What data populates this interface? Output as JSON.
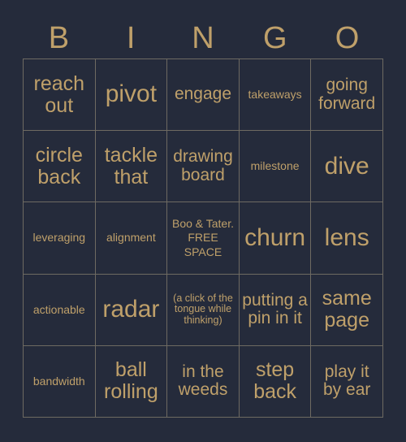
{
  "card": {
    "background_color": "#252b3b",
    "text_color": "#bfa06a",
    "border_color": "#6e6a62"
  },
  "header": {
    "letters": [
      {
        "label": "B"
      },
      {
        "label": "I"
      },
      {
        "label": "N"
      },
      {
        "label": "G"
      },
      {
        "label": "O"
      }
    ]
  },
  "grid": {
    "columns": 5,
    "rows": 5,
    "cells": [
      {
        "text": "reach out",
        "size": "size-lg",
        "row": 1,
        "column": 1,
        "free_space": false
      },
      {
        "text": "pivot",
        "size": "size-xl",
        "row": 1,
        "column": 2,
        "free_space": false
      },
      {
        "text": "engage",
        "size": "size-md",
        "row": 1,
        "column": 3,
        "free_space": false
      },
      {
        "text": "takeaways",
        "size": "size-sm",
        "row": 1,
        "column": 4,
        "free_space": false
      },
      {
        "text": "going forward",
        "size": "size-md",
        "row": 1,
        "column": 5,
        "free_space": false
      },
      {
        "text": "circle back",
        "size": "size-lg",
        "row": 2,
        "column": 1,
        "free_space": false
      },
      {
        "text": "tackle that",
        "size": "size-lg",
        "row": 2,
        "column": 2,
        "free_space": false
      },
      {
        "text": "drawing board",
        "size": "size-md",
        "row": 2,
        "column": 3,
        "free_space": false
      },
      {
        "text": "milestone",
        "size": "size-sm",
        "row": 2,
        "column": 4,
        "free_space": false
      },
      {
        "text": "dive",
        "size": "size-xl",
        "row": 2,
        "column": 5,
        "free_space": false
      },
      {
        "text": "leveraging",
        "size": "size-sm",
        "row": 3,
        "column": 1,
        "free_space": false
      },
      {
        "text": "alignment",
        "size": "size-sm",
        "row": 3,
        "column": 2,
        "free_space": false
      },
      {
        "text": "Boo & Tater. FREE SPACE",
        "size": "size-free",
        "row": 3,
        "column": 3,
        "free_space": true
      },
      {
        "text": "churn",
        "size": "size-xl",
        "row": 3,
        "column": 4,
        "free_space": false
      },
      {
        "text": "lens",
        "size": "size-xl",
        "row": 3,
        "column": 5,
        "free_space": false
      },
      {
        "text": "actionable",
        "size": "size-sm",
        "row": 4,
        "column": 1,
        "free_space": false
      },
      {
        "text": "radar",
        "size": "size-xl",
        "row": 4,
        "column": 2,
        "free_space": false
      },
      {
        "text": "(a click of the tongue while thinking)",
        "size": "size-xs",
        "row": 4,
        "column": 3,
        "free_space": false
      },
      {
        "text": "putting a pin in it",
        "size": "size-md",
        "row": 4,
        "column": 4,
        "free_space": false
      },
      {
        "text": "same page",
        "size": "size-lg",
        "row": 4,
        "column": 5,
        "free_space": false
      },
      {
        "text": "bandwidth",
        "size": "size-sm",
        "row": 5,
        "column": 1,
        "free_space": false
      },
      {
        "text": "ball rolling",
        "size": "size-lg",
        "row": 5,
        "column": 2,
        "free_space": false
      },
      {
        "text": "in the weeds",
        "size": "size-md",
        "row": 5,
        "column": 3,
        "free_space": false
      },
      {
        "text": "step back",
        "size": "size-lg",
        "row": 5,
        "column": 4,
        "free_space": false
      },
      {
        "text": "play it by ear",
        "size": "size-md",
        "row": 5,
        "column": 5,
        "free_space": false
      }
    ]
  }
}
